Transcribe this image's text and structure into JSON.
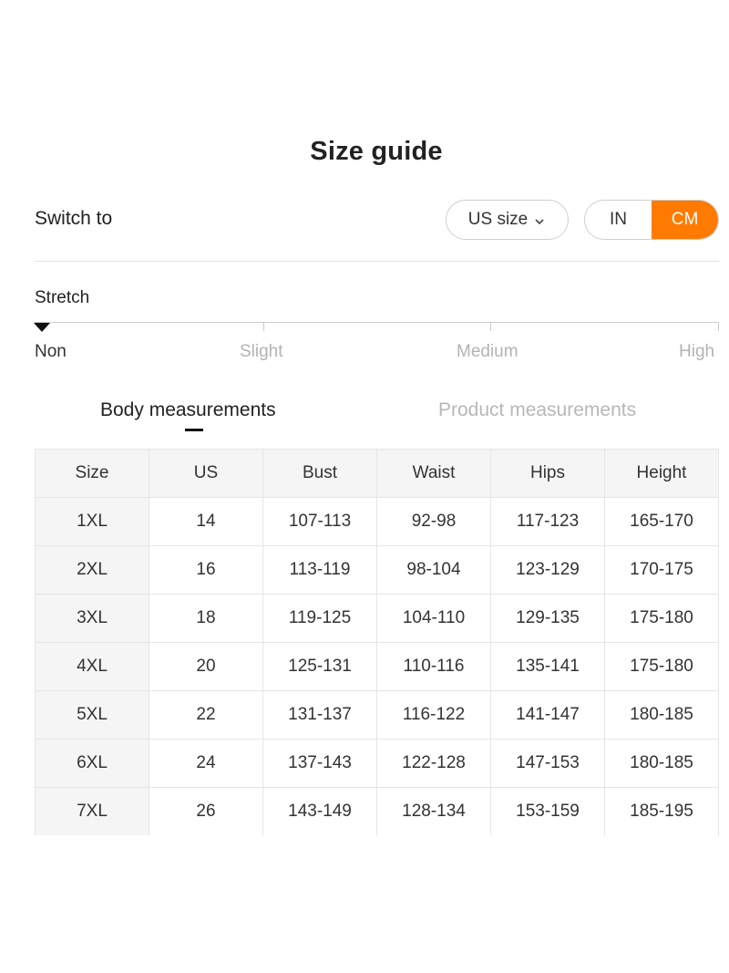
{
  "title": "Size guide",
  "switch_label": "Switch to",
  "size_select": {
    "value": "US size",
    "icon": "chevron-down-icon"
  },
  "unit_toggle": {
    "options": [
      "IN",
      "CM"
    ],
    "selected": "CM"
  },
  "stretch": {
    "label": "Stretch",
    "levels": [
      "Non",
      "Slight",
      "Medium",
      "High"
    ],
    "selected": "Non"
  },
  "tabs": {
    "items": [
      "Body measurements",
      "Product measurements"
    ],
    "active": "Body measurements"
  },
  "table": {
    "headers": [
      "Size",
      "US",
      "Bust",
      "Waist",
      "Hips",
      "Height"
    ],
    "rows": [
      [
        "1XL",
        "14",
        "107-113",
        "92-98",
        "117-123",
        "165-170"
      ],
      [
        "2XL",
        "16",
        "113-119",
        "98-104",
        "123-129",
        "170-175"
      ],
      [
        "3XL",
        "18",
        "119-125",
        "104-110",
        "129-135",
        "175-180"
      ],
      [
        "4XL",
        "20",
        "125-131",
        "110-116",
        "135-141",
        "175-180"
      ],
      [
        "5XL",
        "22",
        "131-137",
        "116-122",
        "141-147",
        "180-185"
      ],
      [
        "6XL",
        "24",
        "137-143",
        "122-128",
        "147-153",
        "180-185"
      ],
      [
        "7XL",
        "26",
        "143-149",
        "128-134",
        "153-159",
        "185-195"
      ]
    ]
  },
  "colors": {
    "accent": "#ff7a00",
    "text": "#222222",
    "muted": "#b3b3b3",
    "table_header_bg": "#f5f5f5"
  }
}
